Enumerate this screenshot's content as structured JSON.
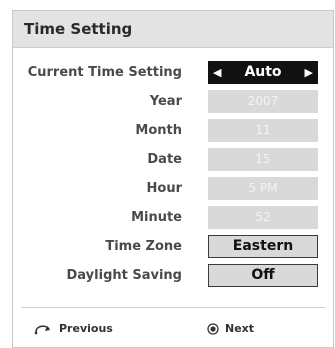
{
  "dialog": {
    "title": "Time Setting",
    "rows": [
      {
        "label": "Current Time Setting",
        "value": "Auto",
        "state": "selected"
      },
      {
        "label": "Year",
        "value": "2007",
        "state": "disabled"
      },
      {
        "label": "Month",
        "value": "11",
        "state": "disabled"
      },
      {
        "label": "Date",
        "value": "15",
        "state": "disabled"
      },
      {
        "label": "Hour",
        "value": "5 PM",
        "state": "disabled"
      },
      {
        "label": "Minute",
        "value": "52",
        "state": "disabled"
      },
      {
        "label": "Time Zone",
        "value": "Eastern",
        "state": "enabled"
      },
      {
        "label": "Daylight Saving",
        "value": "Off",
        "state": "enabled"
      }
    ],
    "arrows": {
      "left": "◀",
      "right": "▶"
    }
  },
  "footer": {
    "previous_label": "Previous",
    "previous_icon": "return-icon",
    "next_label": "Next",
    "next_icon": "ok-button-icon"
  },
  "colors": {
    "title_bg": "#e3e3e3",
    "selected_bg": "#111111",
    "field_bg": "#d9d9d9"
  }
}
